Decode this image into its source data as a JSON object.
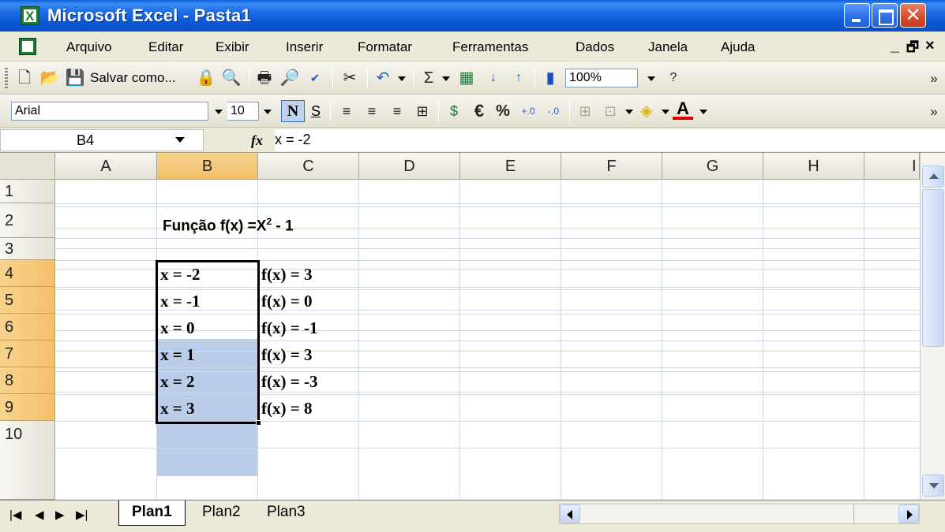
{
  "window": {
    "title": "Microsoft Excel - Pasta1",
    "close_glyph": "✕"
  },
  "menu": {
    "items": [
      "Arquivo",
      "Editar",
      "Exibir",
      "Inserir",
      "Formatar",
      "Ferramentas",
      "Dados",
      "Janela",
      "Ajuda"
    ],
    "min_glyph": "_",
    "restore_glyph": "🗗",
    "close_glyph": "×"
  },
  "toolbar": {
    "save_as_label": "Salvar como...",
    "sum_glyph": "Σ",
    "zoom": "100%",
    "overflow_glyph": "»",
    "font_name": "Arial",
    "font_size": "10",
    "bold_label": "N",
    "underline_label": "S",
    "currency_glyph": "€",
    "percent_glyph": "%",
    "font_color_label": "A"
  },
  "formula_bar": {
    "name_box": "B4",
    "fx_label": "fx",
    "formula": "x = -2"
  },
  "sheet": {
    "columns": [
      "A",
      "B",
      "C",
      "D",
      "E",
      "F",
      "G",
      "H",
      "I"
    ],
    "rows": [
      "1",
      "2",
      "3",
      "4",
      "5",
      "6",
      "7",
      "8",
      "9",
      "10"
    ],
    "title_prefix": "Função f(x) =X",
    "title_superscript": "2",
    "title_suffix": " - 1",
    "x_values": [
      "x = -2",
      "x = -1",
      "x = 0",
      "x = 1",
      "x = 2",
      "x = 3"
    ],
    "fx_values": [
      "f(x) = 3",
      "f(x) = 0",
      "f(x) = -1",
      "f(x) = 3",
      "f(x) = -3",
      "f(x) = 8"
    ]
  },
  "tabs": {
    "nav": [
      "|◀",
      "◀",
      "▶",
      "▶|"
    ],
    "sheets": [
      "Plan1",
      "Plan2",
      "Plan3"
    ],
    "active": "Plan1"
  }
}
